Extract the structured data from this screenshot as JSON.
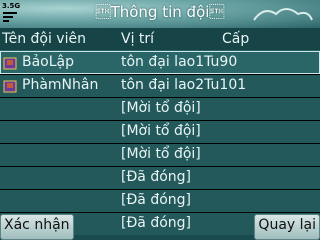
{
  "status": {
    "network": "3.5G"
  },
  "window": {
    "title": "\u0002Thông tin đội\u0002"
  },
  "table": {
    "headers": [
      "Tên đội viên",
      "Vị trí",
      "Cấp"
    ],
    "rows": [
      {
        "name": "BảoLập",
        "position": "tôn đại lao1Tu90"
      },
      {
        "name": "PhàmNhân",
        "position": "tôn đại lao2Tu101"
      },
      {
        "name": "",
        "position": "[Mời tổ đội]"
      },
      {
        "name": "",
        "position": "[Mời tổ đội]"
      },
      {
        "name": "",
        "position": "[Mời tổ đội]"
      },
      {
        "name": "",
        "position": "[Đã đóng]"
      },
      {
        "name": "",
        "position": "[Đã đóng]"
      },
      {
        "name": "",
        "position": "[Đã đóng]"
      }
    ]
  },
  "softkeys": {
    "left": "Xác nhận",
    "right": "Quay lại"
  },
  "colors": {
    "title_bg": "#6fa8a8",
    "row_bg": "#24595c",
    "header_bg": "#174547",
    "text": "#e8f4f4"
  }
}
